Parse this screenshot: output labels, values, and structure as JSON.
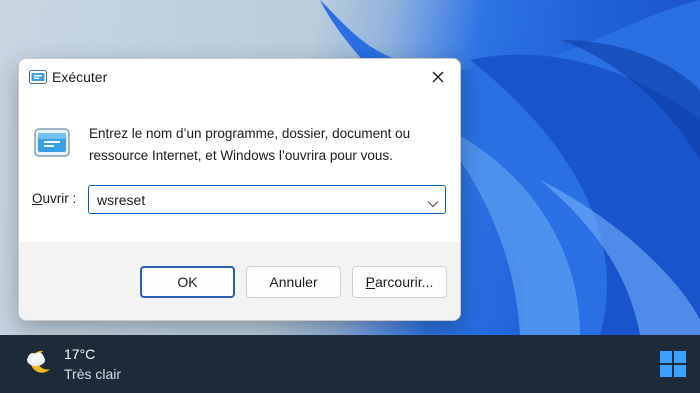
{
  "dialog": {
    "title": "Exécuter",
    "description": "Entrez le nom d’un programme, dossier, document ou ressource Internet, et Windows l’ouvrira pour vous.",
    "open_label_accel": "O",
    "open_label_rest": "uvrir :",
    "command_value": "wsreset",
    "buttons": {
      "ok": "OK",
      "cancel": "Annuler",
      "browse_accel": "P",
      "browse_rest": "arcourir..."
    },
    "icons": {
      "title": "run-icon",
      "large": "run-icon",
      "close": "close-icon",
      "dropdown": "chevron-down-icon"
    }
  },
  "taskbar": {
    "weather": {
      "temperature": "17°C",
      "condition": "Très clair",
      "icon": "moon-cloud-icon"
    },
    "start_icon": "windows-logo-icon"
  },
  "colors": {
    "accent": "#0067c0",
    "taskbar": "#1c2a3a",
    "wallpaper_blue": "#1f5fd9",
    "start_blue": "#3aa0ff",
    "moon_yellow": "#f2b81b"
  }
}
